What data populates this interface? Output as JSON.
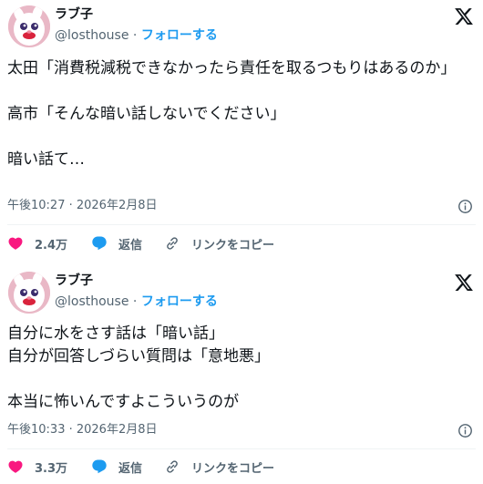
{
  "tweets": [
    {
      "author_name": "ラブ子",
      "handle": "@losthouse",
      "separator": "·",
      "follow_label": "フォローする",
      "lines": [
        "太田「消費税減税できなかったら責任を取るつもりはあるのか」",
        "",
        "高市「そんな暗い話しないでください」",
        "",
        "暗い話て…"
      ],
      "timestamp": "午後10:27 · 2026年2月8日",
      "likes": "2.4万",
      "reply_label": "返信",
      "copy_link_label": "リンクをコピー"
    },
    {
      "author_name": "ラブ子",
      "handle": "@losthouse",
      "separator": "·",
      "follow_label": "フォローする",
      "lines": [
        "自分に水をさす話は「暗い話」",
        "自分が回答しづらい質問は「意地悪」",
        "",
        "本当に怖いんですよこういうのが"
      ],
      "timestamp": "午後10:33 · 2026年2月8日",
      "likes": "3.3万",
      "reply_label": "返信",
      "copy_link_label": "リンクをコピー"
    }
  ],
  "colors": {
    "text": "#0f1419",
    "secondary": "#536471",
    "accent": "#1d9bf0",
    "like": "#f91880",
    "divider": "#eff3f4"
  },
  "icons": [
    "x-logo-icon",
    "info-icon",
    "heart-icon",
    "reply-bubble-icon",
    "link-icon"
  ]
}
